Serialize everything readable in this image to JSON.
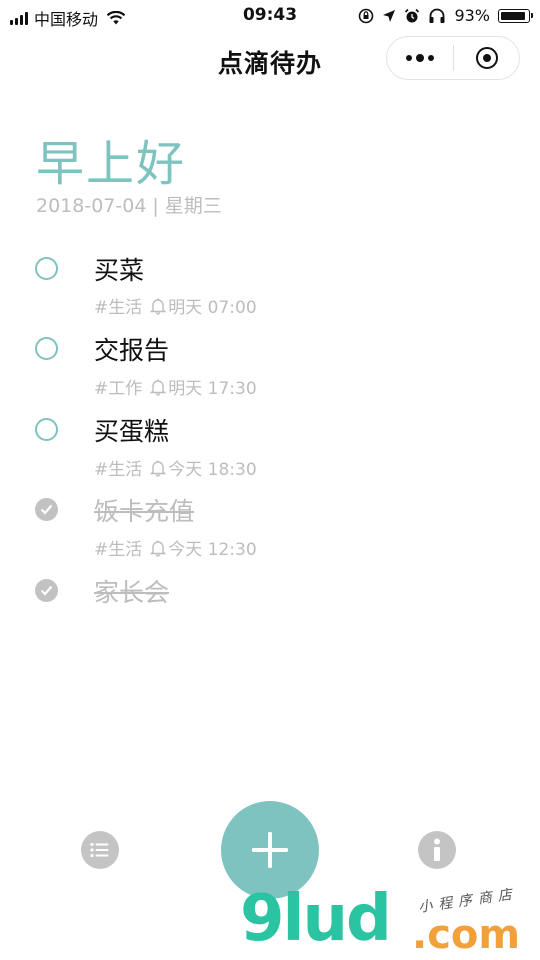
{
  "status_bar": {
    "carrier": "中国移动",
    "time": "09:43",
    "battery": "93%",
    "battery_level": 0.93
  },
  "nav": {
    "title": "点滴待办"
  },
  "greeting": "早上好",
  "date": {
    "day": "2018-07-04",
    "separator": "|",
    "weekday": "星期三"
  },
  "tasks": [
    {
      "title": "买菜",
      "tag": "#生活",
      "reminder": "明天 07:00",
      "done": false
    },
    {
      "title": "交报告",
      "tag": "#工作",
      "reminder": "明天 17:30",
      "done": false
    },
    {
      "title": "买蛋糕",
      "tag": "#生活",
      "reminder": "今天 18:30",
      "done": false
    },
    {
      "title": "饭卡充值",
      "tag": "#生活",
      "reminder": "今天 12:30",
      "done": true
    },
    {
      "title": "家长会",
      "done": true
    }
  ],
  "icons": {
    "list": "list-icon",
    "add": "plus-icon",
    "info": "info-icon"
  },
  "colors": {
    "accent": "#7fc3c0",
    "muted": "#bdbdbd",
    "done_check": "#c2c2c2"
  },
  "watermark": {
    "logo": "9lud",
    "domain": ".com",
    "tagline": "小程序商店"
  }
}
